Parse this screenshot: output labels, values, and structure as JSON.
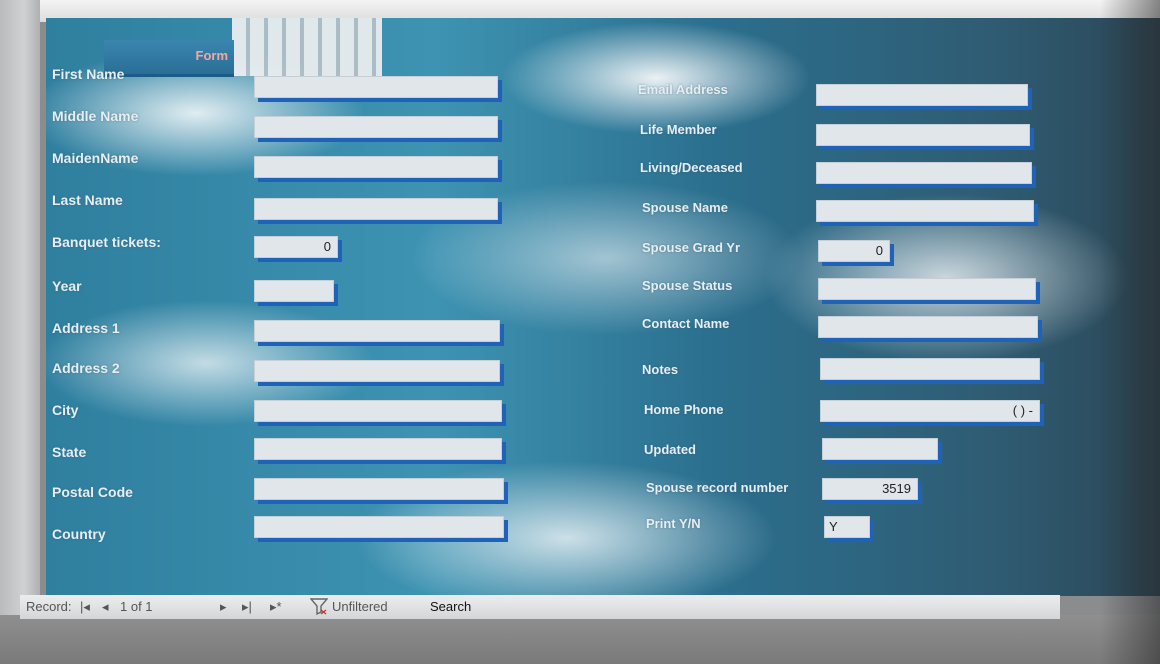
{
  "form": {
    "tab_title": "Form"
  },
  "left_fields": [
    {
      "label": "First Name",
      "value": ""
    },
    {
      "label": "Middle Name",
      "value": ""
    },
    {
      "label": "MaidenName",
      "value": ""
    },
    {
      "label": "Last Name",
      "value": ""
    },
    {
      "label": "Banquet tickets:",
      "value": "0"
    },
    {
      "label": "Year",
      "value": ""
    },
    {
      "label": "Address 1",
      "value": ""
    },
    {
      "label": "Address 2",
      "value": ""
    },
    {
      "label": "City",
      "value": ""
    },
    {
      "label": "State",
      "value": ""
    },
    {
      "label": "Postal Code",
      "value": ""
    },
    {
      "label": "Country",
      "value": ""
    }
  ],
  "right_fields": [
    {
      "label": "Email Address",
      "value": ""
    },
    {
      "label": "Life Member",
      "value": ""
    },
    {
      "label": "Living/Deceased",
      "value": ""
    },
    {
      "label": "Spouse Name",
      "value": ""
    },
    {
      "label": "Spouse Grad Yr",
      "value": "0"
    },
    {
      "label": "Spouse Status",
      "value": ""
    },
    {
      "label": "Contact Name",
      "value": ""
    },
    {
      "label": "Notes",
      "value": ""
    },
    {
      "label": "Home Phone",
      "value": "(   )   -"
    },
    {
      "label": "Updated",
      "value": ""
    },
    {
      "label": "Spouse record number",
      "value": "3519"
    },
    {
      "label": "Print Y/N",
      "value": "Y"
    }
  ],
  "nav": {
    "record_label": "Record:",
    "first_icon": "first-record-icon",
    "prev_icon": "previous-record-icon",
    "position": "1 of 1",
    "next_icon": "next-record-icon",
    "last_icon": "last-record-icon",
    "new_icon": "new-record-icon",
    "filter_icon": "filter-icon",
    "filter_status": "Unfiltered",
    "search_label": "Search"
  }
}
